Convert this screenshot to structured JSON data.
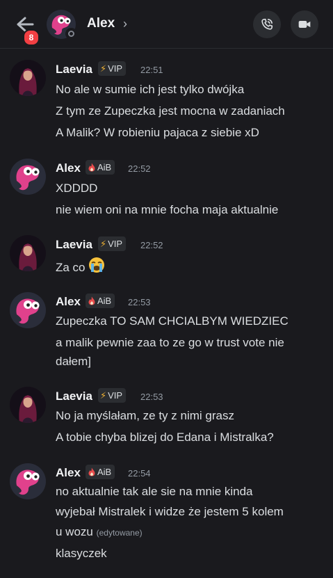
{
  "header": {
    "badge_count": "8",
    "contact_name": "Alex",
    "chevron": "›"
  },
  "messages": [
    {
      "author": "Laevia",
      "role_icon": "⚡",
      "role": "VIP",
      "time": "22:51",
      "lines": [
        "No ale w sumie ich jest tylko dwójka",
        "Z tym ze Zupeczka jest mocna w zadaniach",
        "A Malik? W robieniu pajaca z siebie xD"
      ]
    },
    {
      "author": "Alex",
      "role_icon": "flame-icon",
      "role": "AiB",
      "time": "22:52",
      "lines": [
        "XDDDD",
        "nie wiem oni na mnie focha maja aktualnie"
      ]
    },
    {
      "author": "Laevia",
      "role_icon": "⚡",
      "role": "VIP",
      "time": "22:52",
      "lines": [
        "Za co"
      ]
    },
    {
      "author": "Alex",
      "role_icon": "flame-icon",
      "role": "AiB",
      "time": "22:53",
      "lines": [
        "Zupeczka TO SAM CHCIALBYM WIEDZIEC",
        "a malik pewnie zaa to ze go w trust vote nie",
        "dałem]"
      ]
    },
    {
      "author": "Laevia",
      "role_icon": "⚡",
      "role": "VIP",
      "time": "22:53",
      "lines": [
        "No ja myślałam, ze ty z nimi grasz",
        "A tobie chyba blizej do Edana i Mistralka?"
      ]
    },
    {
      "author": "Alex",
      "role_icon": "flame-icon",
      "role": "AiB",
      "time": "22:54",
      "lines": [
        "no aktualnie tak ale sie na mnie kinda",
        "wyjebał Mistralek i widze że jestem 5 kolem",
        "u wozu",
        "klasyczek"
      ],
      "edited": "(edytowane)"
    }
  ]
}
